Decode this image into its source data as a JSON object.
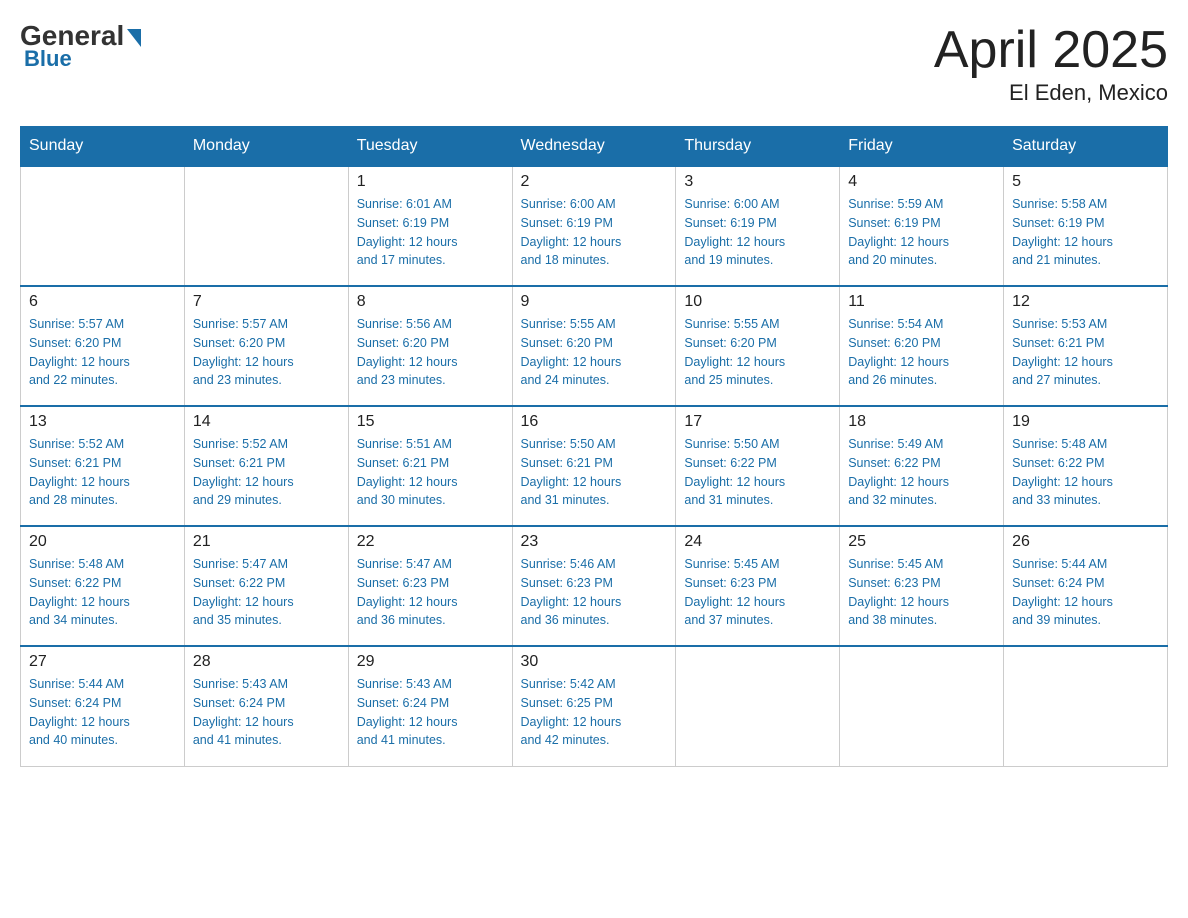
{
  "logo": {
    "general": "General",
    "blue": "Blue"
  },
  "title": "April 2025",
  "subtitle": "El Eden, Mexico",
  "days": [
    "Sunday",
    "Monday",
    "Tuesday",
    "Wednesday",
    "Thursday",
    "Friday",
    "Saturday"
  ],
  "weeks": [
    [
      {
        "num": "",
        "info": ""
      },
      {
        "num": "",
        "info": ""
      },
      {
        "num": "1",
        "info": "Sunrise: 6:01 AM\nSunset: 6:19 PM\nDaylight: 12 hours\nand 17 minutes."
      },
      {
        "num": "2",
        "info": "Sunrise: 6:00 AM\nSunset: 6:19 PM\nDaylight: 12 hours\nand 18 minutes."
      },
      {
        "num": "3",
        "info": "Sunrise: 6:00 AM\nSunset: 6:19 PM\nDaylight: 12 hours\nand 19 minutes."
      },
      {
        "num": "4",
        "info": "Sunrise: 5:59 AM\nSunset: 6:19 PM\nDaylight: 12 hours\nand 20 minutes."
      },
      {
        "num": "5",
        "info": "Sunrise: 5:58 AM\nSunset: 6:19 PM\nDaylight: 12 hours\nand 21 minutes."
      }
    ],
    [
      {
        "num": "6",
        "info": "Sunrise: 5:57 AM\nSunset: 6:20 PM\nDaylight: 12 hours\nand 22 minutes."
      },
      {
        "num": "7",
        "info": "Sunrise: 5:57 AM\nSunset: 6:20 PM\nDaylight: 12 hours\nand 23 minutes."
      },
      {
        "num": "8",
        "info": "Sunrise: 5:56 AM\nSunset: 6:20 PM\nDaylight: 12 hours\nand 23 minutes."
      },
      {
        "num": "9",
        "info": "Sunrise: 5:55 AM\nSunset: 6:20 PM\nDaylight: 12 hours\nand 24 minutes."
      },
      {
        "num": "10",
        "info": "Sunrise: 5:55 AM\nSunset: 6:20 PM\nDaylight: 12 hours\nand 25 minutes."
      },
      {
        "num": "11",
        "info": "Sunrise: 5:54 AM\nSunset: 6:20 PM\nDaylight: 12 hours\nand 26 minutes."
      },
      {
        "num": "12",
        "info": "Sunrise: 5:53 AM\nSunset: 6:21 PM\nDaylight: 12 hours\nand 27 minutes."
      }
    ],
    [
      {
        "num": "13",
        "info": "Sunrise: 5:52 AM\nSunset: 6:21 PM\nDaylight: 12 hours\nand 28 minutes."
      },
      {
        "num": "14",
        "info": "Sunrise: 5:52 AM\nSunset: 6:21 PM\nDaylight: 12 hours\nand 29 minutes."
      },
      {
        "num": "15",
        "info": "Sunrise: 5:51 AM\nSunset: 6:21 PM\nDaylight: 12 hours\nand 30 minutes."
      },
      {
        "num": "16",
        "info": "Sunrise: 5:50 AM\nSunset: 6:21 PM\nDaylight: 12 hours\nand 31 minutes."
      },
      {
        "num": "17",
        "info": "Sunrise: 5:50 AM\nSunset: 6:22 PM\nDaylight: 12 hours\nand 31 minutes."
      },
      {
        "num": "18",
        "info": "Sunrise: 5:49 AM\nSunset: 6:22 PM\nDaylight: 12 hours\nand 32 minutes."
      },
      {
        "num": "19",
        "info": "Sunrise: 5:48 AM\nSunset: 6:22 PM\nDaylight: 12 hours\nand 33 minutes."
      }
    ],
    [
      {
        "num": "20",
        "info": "Sunrise: 5:48 AM\nSunset: 6:22 PM\nDaylight: 12 hours\nand 34 minutes."
      },
      {
        "num": "21",
        "info": "Sunrise: 5:47 AM\nSunset: 6:22 PM\nDaylight: 12 hours\nand 35 minutes."
      },
      {
        "num": "22",
        "info": "Sunrise: 5:47 AM\nSunset: 6:23 PM\nDaylight: 12 hours\nand 36 minutes."
      },
      {
        "num": "23",
        "info": "Sunrise: 5:46 AM\nSunset: 6:23 PM\nDaylight: 12 hours\nand 36 minutes."
      },
      {
        "num": "24",
        "info": "Sunrise: 5:45 AM\nSunset: 6:23 PM\nDaylight: 12 hours\nand 37 minutes."
      },
      {
        "num": "25",
        "info": "Sunrise: 5:45 AM\nSunset: 6:23 PM\nDaylight: 12 hours\nand 38 minutes."
      },
      {
        "num": "26",
        "info": "Sunrise: 5:44 AM\nSunset: 6:24 PM\nDaylight: 12 hours\nand 39 minutes."
      }
    ],
    [
      {
        "num": "27",
        "info": "Sunrise: 5:44 AM\nSunset: 6:24 PM\nDaylight: 12 hours\nand 40 minutes."
      },
      {
        "num": "28",
        "info": "Sunrise: 5:43 AM\nSunset: 6:24 PM\nDaylight: 12 hours\nand 41 minutes."
      },
      {
        "num": "29",
        "info": "Sunrise: 5:43 AM\nSunset: 6:24 PM\nDaylight: 12 hours\nand 41 minutes."
      },
      {
        "num": "30",
        "info": "Sunrise: 5:42 AM\nSunset: 6:25 PM\nDaylight: 12 hours\nand 42 minutes."
      },
      {
        "num": "",
        "info": ""
      },
      {
        "num": "",
        "info": ""
      },
      {
        "num": "",
        "info": ""
      }
    ]
  ]
}
